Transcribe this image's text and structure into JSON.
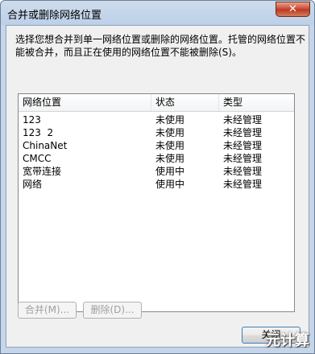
{
  "window": {
    "title": "合并或删除网络位置",
    "close_symbol": "✕"
  },
  "description": "选择您想合并到单一网络位置或删除的网络位置。托管的网络位置不能被合并，而且正在使用的网络位置不能被删除(S)。",
  "list": {
    "columns": [
      "网络位置",
      "状态",
      "类型"
    ],
    "rows": [
      [
        "123",
        "未使用",
        "未经管理"
      ],
      [
        "123  2",
        "未使用",
        "未经管理"
      ],
      [
        "ChinaNet",
        "未使用",
        "未经管理"
      ],
      [
        "CMCC",
        "未使用",
        "未经管理"
      ],
      [
        "宽带连接",
        "使用中",
        "未经管理"
      ],
      [
        "网络",
        "使用中",
        "未经管理"
      ]
    ]
  },
  "buttons": {
    "merge": "合并(M)...",
    "delete": "删除(D)...",
    "close": "关闭"
  },
  "watermark": "元计算",
  "colors": {
    "title_bar": "#bcd0e8",
    "close_button": "#c8452d",
    "client_bg": "#f0f0f0"
  }
}
